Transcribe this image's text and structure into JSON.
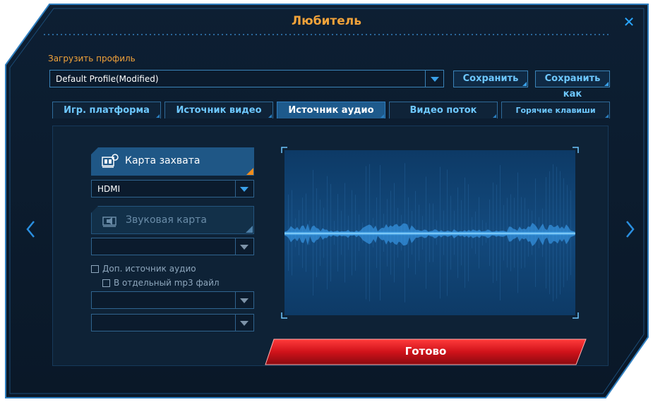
{
  "window": {
    "title": "Любитель",
    "close_icon": "close-icon"
  },
  "profile": {
    "load_label": "Загрузить профиль",
    "selected": "Default Profile(Modified)",
    "save_label": "Сохранить",
    "save_as_label": "Сохранить как"
  },
  "tabs": [
    {
      "label": "Игр. платформа",
      "active": false
    },
    {
      "label": "Источник видео",
      "active": false
    },
    {
      "label": "Источник аудио",
      "active": true
    },
    {
      "label": "Видео поток",
      "active": false
    },
    {
      "label": "Горячие клавиши",
      "active": false
    }
  ],
  "audio_source": {
    "capture_card_label": "Карта захвата",
    "capture_card_selected": "HDMI",
    "sound_card_label": "Звуковая карта",
    "sound_card_selected": "",
    "extra_source_label": "Доп. источник аудио",
    "separate_mp3_label": "В отдельный mp3 файл",
    "extra_select_1": "",
    "extra_select_2": ""
  },
  "done_label": "Готово",
  "colors": {
    "accent_orange": "#f2a33a",
    "accent_blue": "#3aa0e8",
    "done_red": "#d0121a",
    "panel_bg": "#0e2236"
  }
}
